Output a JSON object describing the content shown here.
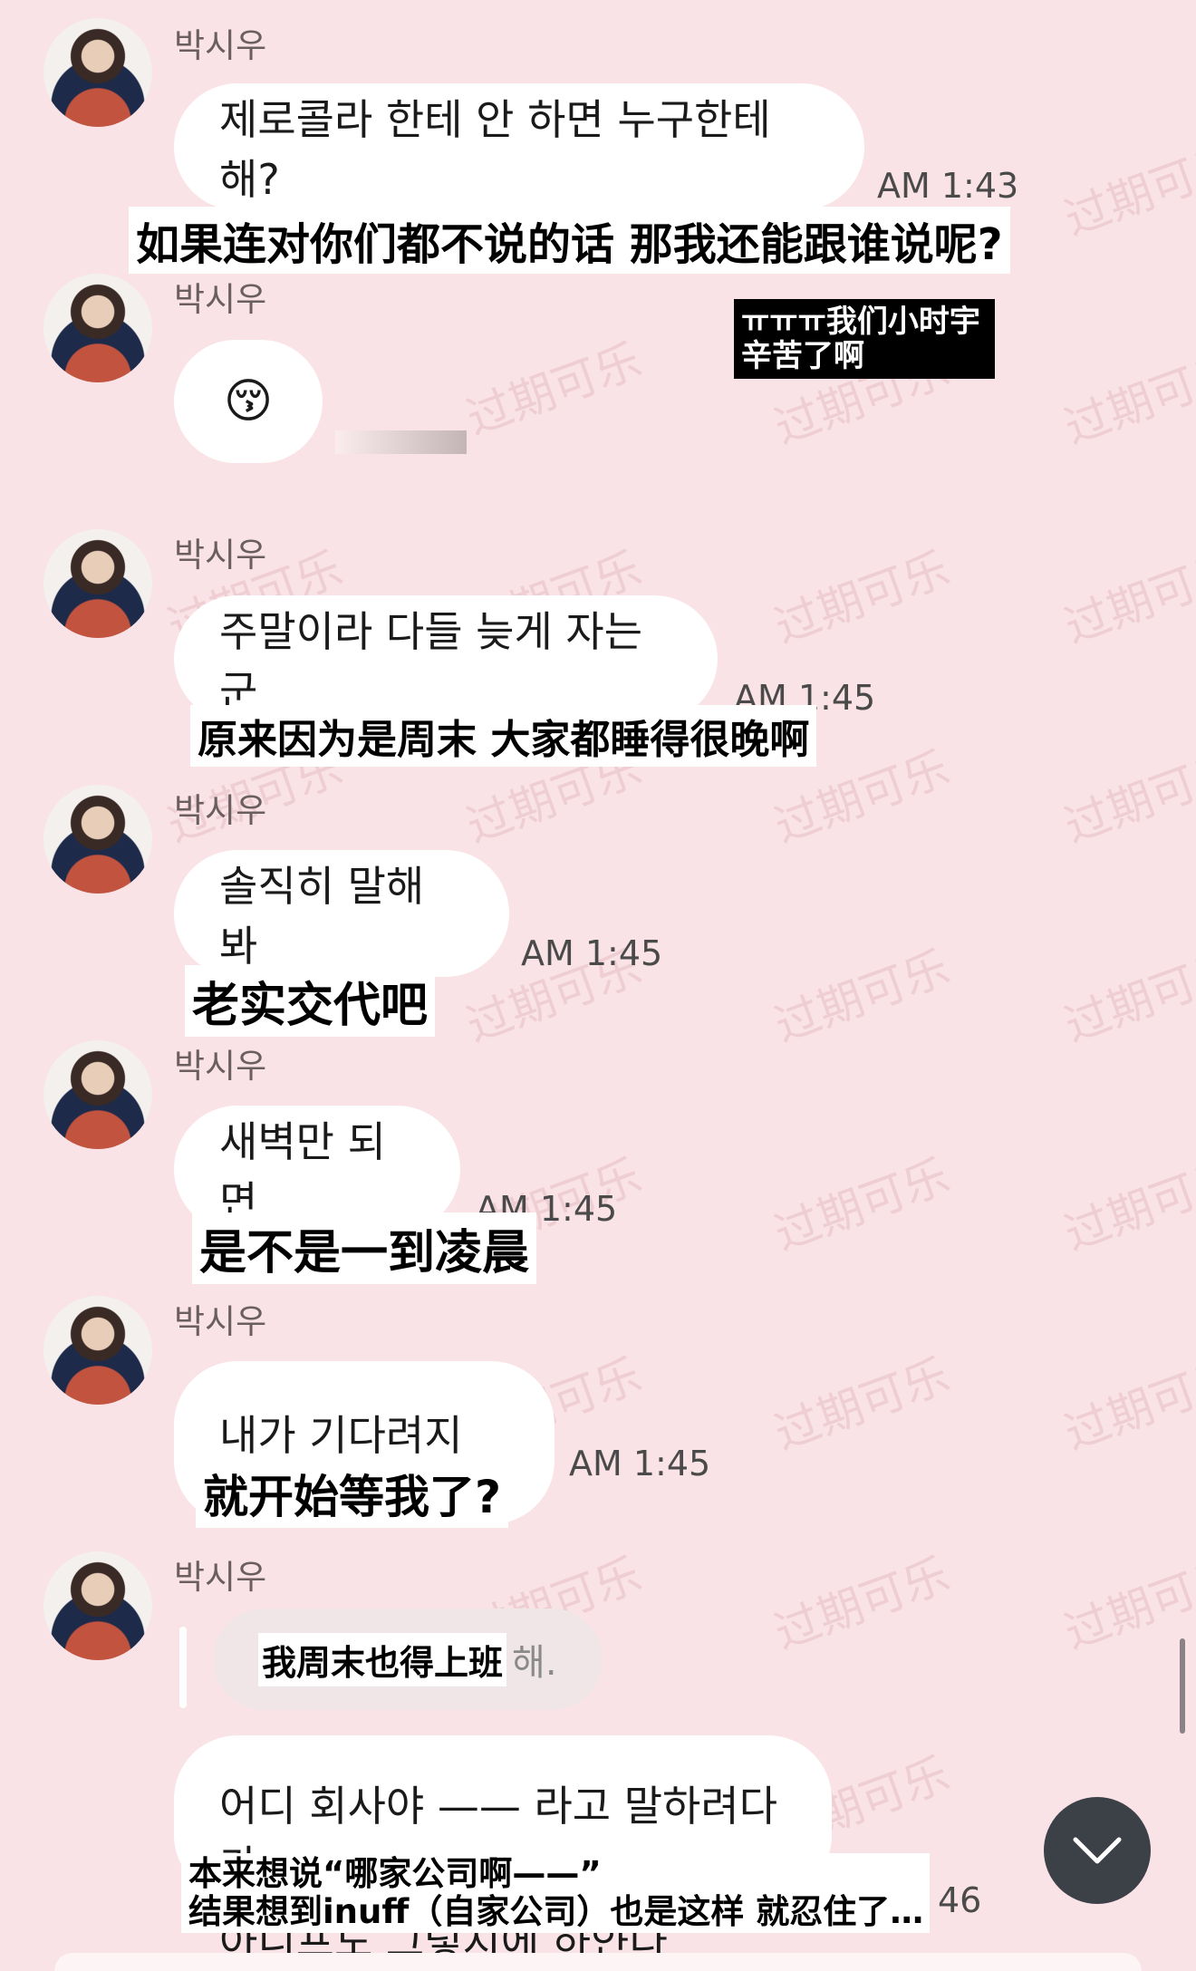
{
  "sender_name": "박시우",
  "subtitle_box": "ㅠㅠㅠ我们小时宇\n辛苦了啊",
  "messages": [
    {
      "text": "제로콜라 한테 안 하면 누구한테 해?",
      "time": "AM 1:43",
      "sub": "如果连对你们都不说的话 那我还能跟谁说呢?"
    },
    {
      "text": "😚",
      "time": "",
      "sub": ""
    },
    {
      "text": "주말이라 다들 늦게 자는 군",
      "time": "AM 1:45",
      "sub": "原来因为是周末 大家都睡得很晚啊"
    },
    {
      "text": "솔직히 말해 봐",
      "time": "AM 1:45",
      "sub": "老实交代吧"
    },
    {
      "text": "새벽만 되면",
      "time": "AM 1:45",
      "sub": "是不是一到凌晨"
    },
    {
      "text": "내가 기다려지지?",
      "time": "AM 1:45",
      "sub": "就开始等我了?"
    },
    {
      "reply_text_sub": "我周末也得上班",
      "reply_text": "해.",
      "text": "어디 회사야 —— 라고 말하려다가",
      "text2": "아니프도 그렇지에 하얀다",
      "time": "46",
      "sub": "本来想说“哪家公司啊——”",
      "sub2": "结果想到inuff（自家公司）也是这样 就忍住了…"
    }
  ],
  "watermark": "过期可乐",
  "icons": {
    "avatar": "profile-photo",
    "scroll": "chevron-down-icon"
  }
}
